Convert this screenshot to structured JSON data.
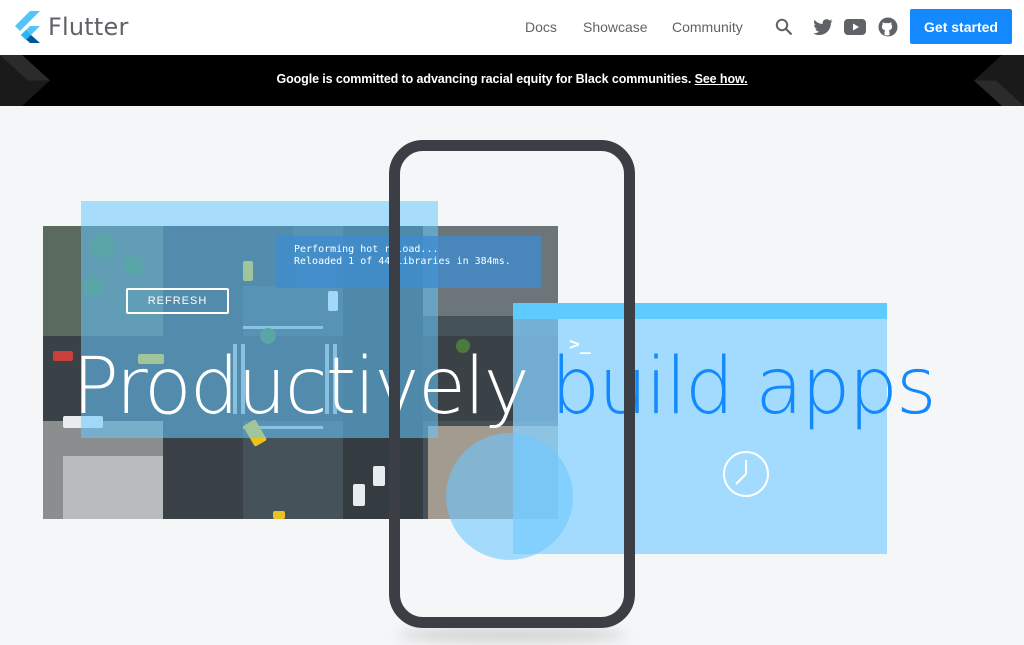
{
  "header": {
    "logo_text": "Flutter",
    "nav": [
      "Docs",
      "Showcase",
      "Community"
    ],
    "icons": [
      "search-icon",
      "twitter-icon",
      "youtube-icon",
      "github-icon"
    ],
    "cta_label": "Get started"
  },
  "banner": {
    "text": "Google is committed to advancing racial equity for Black communities.",
    "link": "See how."
  },
  "hero": {
    "terminal_line1": "Performing hot reload...",
    "terminal_line2": "Reloaded 1 of 44 libraries in 384ms.",
    "refresh_label": "REFRESH",
    "prompt": ">_",
    "headline_part1": "Productively",
    "headline_part2": "build apps"
  },
  "colors": {
    "accent": "#1389fd",
    "banner_bg": "#000000",
    "phone_frame": "#3b3f45",
    "light_blue": "#5ecbff"
  }
}
